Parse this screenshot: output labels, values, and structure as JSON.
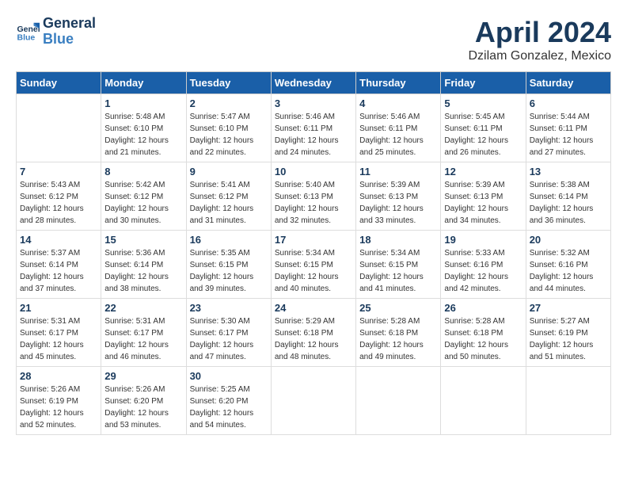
{
  "header": {
    "logo_line1": "General",
    "logo_line2": "Blue",
    "month_title": "April 2024",
    "location": "Dzilam Gonzalez, Mexico"
  },
  "calendar": {
    "days_of_week": [
      "Sunday",
      "Monday",
      "Tuesday",
      "Wednesday",
      "Thursday",
      "Friday",
      "Saturday"
    ],
    "weeks": [
      [
        {
          "day": "",
          "info": ""
        },
        {
          "day": "1",
          "info": "Sunrise: 5:48 AM\nSunset: 6:10 PM\nDaylight: 12 hours\nand 21 minutes."
        },
        {
          "day": "2",
          "info": "Sunrise: 5:47 AM\nSunset: 6:10 PM\nDaylight: 12 hours\nand 22 minutes."
        },
        {
          "day": "3",
          "info": "Sunrise: 5:46 AM\nSunset: 6:11 PM\nDaylight: 12 hours\nand 24 minutes."
        },
        {
          "day": "4",
          "info": "Sunrise: 5:46 AM\nSunset: 6:11 PM\nDaylight: 12 hours\nand 25 minutes."
        },
        {
          "day": "5",
          "info": "Sunrise: 5:45 AM\nSunset: 6:11 PM\nDaylight: 12 hours\nand 26 minutes."
        },
        {
          "day": "6",
          "info": "Sunrise: 5:44 AM\nSunset: 6:11 PM\nDaylight: 12 hours\nand 27 minutes."
        }
      ],
      [
        {
          "day": "7",
          "info": "Sunrise: 5:43 AM\nSunset: 6:12 PM\nDaylight: 12 hours\nand 28 minutes."
        },
        {
          "day": "8",
          "info": "Sunrise: 5:42 AM\nSunset: 6:12 PM\nDaylight: 12 hours\nand 30 minutes."
        },
        {
          "day": "9",
          "info": "Sunrise: 5:41 AM\nSunset: 6:12 PM\nDaylight: 12 hours\nand 31 minutes."
        },
        {
          "day": "10",
          "info": "Sunrise: 5:40 AM\nSunset: 6:13 PM\nDaylight: 12 hours\nand 32 minutes."
        },
        {
          "day": "11",
          "info": "Sunrise: 5:39 AM\nSunset: 6:13 PM\nDaylight: 12 hours\nand 33 minutes."
        },
        {
          "day": "12",
          "info": "Sunrise: 5:39 AM\nSunset: 6:13 PM\nDaylight: 12 hours\nand 34 minutes."
        },
        {
          "day": "13",
          "info": "Sunrise: 5:38 AM\nSunset: 6:14 PM\nDaylight: 12 hours\nand 36 minutes."
        }
      ],
      [
        {
          "day": "14",
          "info": "Sunrise: 5:37 AM\nSunset: 6:14 PM\nDaylight: 12 hours\nand 37 minutes."
        },
        {
          "day": "15",
          "info": "Sunrise: 5:36 AM\nSunset: 6:14 PM\nDaylight: 12 hours\nand 38 minutes."
        },
        {
          "day": "16",
          "info": "Sunrise: 5:35 AM\nSunset: 6:15 PM\nDaylight: 12 hours\nand 39 minutes."
        },
        {
          "day": "17",
          "info": "Sunrise: 5:34 AM\nSunset: 6:15 PM\nDaylight: 12 hours\nand 40 minutes."
        },
        {
          "day": "18",
          "info": "Sunrise: 5:34 AM\nSunset: 6:15 PM\nDaylight: 12 hours\nand 41 minutes."
        },
        {
          "day": "19",
          "info": "Sunrise: 5:33 AM\nSunset: 6:16 PM\nDaylight: 12 hours\nand 42 minutes."
        },
        {
          "day": "20",
          "info": "Sunrise: 5:32 AM\nSunset: 6:16 PM\nDaylight: 12 hours\nand 44 minutes."
        }
      ],
      [
        {
          "day": "21",
          "info": "Sunrise: 5:31 AM\nSunset: 6:17 PM\nDaylight: 12 hours\nand 45 minutes."
        },
        {
          "day": "22",
          "info": "Sunrise: 5:31 AM\nSunset: 6:17 PM\nDaylight: 12 hours\nand 46 minutes."
        },
        {
          "day": "23",
          "info": "Sunrise: 5:30 AM\nSunset: 6:17 PM\nDaylight: 12 hours\nand 47 minutes."
        },
        {
          "day": "24",
          "info": "Sunrise: 5:29 AM\nSunset: 6:18 PM\nDaylight: 12 hours\nand 48 minutes."
        },
        {
          "day": "25",
          "info": "Sunrise: 5:28 AM\nSunset: 6:18 PM\nDaylight: 12 hours\nand 49 minutes."
        },
        {
          "day": "26",
          "info": "Sunrise: 5:28 AM\nSunset: 6:18 PM\nDaylight: 12 hours\nand 50 minutes."
        },
        {
          "day": "27",
          "info": "Sunrise: 5:27 AM\nSunset: 6:19 PM\nDaylight: 12 hours\nand 51 minutes."
        }
      ],
      [
        {
          "day": "28",
          "info": "Sunrise: 5:26 AM\nSunset: 6:19 PM\nDaylight: 12 hours\nand 52 minutes."
        },
        {
          "day": "29",
          "info": "Sunrise: 5:26 AM\nSunset: 6:20 PM\nDaylight: 12 hours\nand 53 minutes."
        },
        {
          "day": "30",
          "info": "Sunrise: 5:25 AM\nSunset: 6:20 PM\nDaylight: 12 hours\nand 54 minutes."
        },
        {
          "day": "",
          "info": ""
        },
        {
          "day": "",
          "info": ""
        },
        {
          "day": "",
          "info": ""
        },
        {
          "day": "",
          "info": ""
        }
      ]
    ]
  }
}
